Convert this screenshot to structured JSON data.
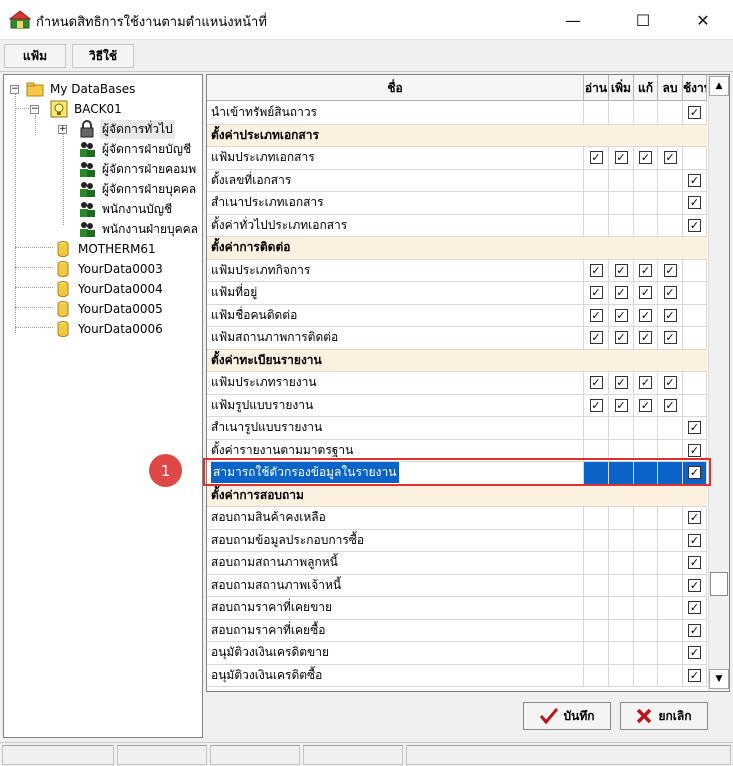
{
  "window": {
    "title": "กำหนดสิทธิการใช้งานตามตำแหน่งหน้าที่",
    "minimize_glyph": "—",
    "maximize_glyph": "☐",
    "close_glyph": "✕"
  },
  "menu": {
    "items": [
      "แฟ้ม",
      "วิธีใช้"
    ]
  },
  "tree": {
    "root": "My DataBases",
    "database": "BACK01",
    "roles": [
      "ผู้จัดการทั่วไป",
      "ผู้จัดการฝ่ายบัญชี",
      "ผู้จัดการฝ่ายคอมพ",
      "ผู้จัดการฝ่ายบุคคล",
      "พนักงานบัญชี",
      "พนักงานฝ่ายบุคคล"
    ],
    "other_databases": [
      "MOTHERM61",
      "YourData0003",
      "YourData0004",
      "YourData0005",
      "YourData0006"
    ]
  },
  "grid": {
    "columns": {
      "name": "ชื่อ",
      "read": "อ่าน",
      "add": "เพิ่ม",
      "edit": "แก้",
      "delete": "ลบ",
      "use": "ใช้งาน"
    },
    "rows": [
      {
        "type": "item",
        "name": "นำเข้าทรัพย์สินถาวร",
        "read": false,
        "add": false,
        "edit": false,
        "delete": false,
        "use": true
      },
      {
        "type": "section",
        "name": "ตั้งค่าประเภทเอกสาร"
      },
      {
        "type": "item",
        "name": "แฟ้มประเภทเอกสาร",
        "read": true,
        "add": true,
        "edit": true,
        "delete": true,
        "use": false
      },
      {
        "type": "item",
        "name": "ตั้งเลขที่เอกสาร",
        "read": false,
        "add": false,
        "edit": false,
        "delete": false,
        "use": true
      },
      {
        "type": "item",
        "name": "สำเนาประเภทเอกสาร",
        "read": false,
        "add": false,
        "edit": false,
        "delete": false,
        "use": true
      },
      {
        "type": "item",
        "name": "ตั้งค่าทั่วไปประเภทเอกสาร",
        "read": false,
        "add": false,
        "edit": false,
        "delete": false,
        "use": true
      },
      {
        "type": "section",
        "name": "ตั้งค่าการติดต่อ"
      },
      {
        "type": "item",
        "name": "แฟ้มประเภทกิจการ",
        "read": true,
        "add": true,
        "edit": true,
        "delete": true,
        "use": false
      },
      {
        "type": "item",
        "name": "แฟ้มที่อยู่",
        "read": true,
        "add": true,
        "edit": true,
        "delete": true,
        "use": false
      },
      {
        "type": "item",
        "name": "แฟ้มชื่อคนติดต่อ",
        "read": true,
        "add": true,
        "edit": true,
        "delete": true,
        "use": false
      },
      {
        "type": "item",
        "name": "แฟ้มสถานภาพการติดต่อ",
        "read": true,
        "add": true,
        "edit": true,
        "delete": true,
        "use": false
      },
      {
        "type": "section",
        "name": "ตั้งค่าทะเบียนรายงาน"
      },
      {
        "type": "item",
        "name": "แฟ้มประเภทรายงาน",
        "read": true,
        "add": true,
        "edit": true,
        "delete": true,
        "use": false
      },
      {
        "type": "item",
        "name": "แฟ้มรูปแบบรายงาน",
        "read": true,
        "add": true,
        "edit": true,
        "delete": true,
        "use": false
      },
      {
        "type": "item",
        "name": "สำเนารูปแบบรายงาน",
        "read": false,
        "add": false,
        "edit": false,
        "delete": false,
        "use": true
      },
      {
        "type": "item",
        "name": "ตั้งค่ารายงานตามมาตรฐาน",
        "read": false,
        "add": false,
        "edit": false,
        "delete": false,
        "use": true
      },
      {
        "type": "item",
        "name": "สามารถใช้ตัวกรองข้อมูลในรายงาน",
        "read": false,
        "add": false,
        "edit": false,
        "delete": false,
        "use": true,
        "selected": true
      },
      {
        "type": "section",
        "name": "ตั้งค่าการสอบถาม"
      },
      {
        "type": "item",
        "name": "สอบถามสินค้าคงเหลือ",
        "read": false,
        "add": false,
        "edit": false,
        "delete": false,
        "use": true
      },
      {
        "type": "item",
        "name": "สอบถามข้อมูลประกอบการซื้อ",
        "read": false,
        "add": false,
        "edit": false,
        "delete": false,
        "use": true
      },
      {
        "type": "item",
        "name": "สอบถามสถานภาพลูกหนี้",
        "read": false,
        "add": false,
        "edit": false,
        "delete": false,
        "use": true
      },
      {
        "type": "item",
        "name": "สอบถามสถานภาพเจ้าหนี้",
        "read": false,
        "add": false,
        "edit": false,
        "delete": false,
        "use": true
      },
      {
        "type": "item",
        "name": "สอบถามราคาที่เคยขาย",
        "read": false,
        "add": false,
        "edit": false,
        "delete": false,
        "use": true
      },
      {
        "type": "item",
        "name": "สอบถามราคาที่เคยซื้อ",
        "read": false,
        "add": false,
        "edit": false,
        "delete": false,
        "use": true
      },
      {
        "type": "item",
        "name": "อนุมัติวงเงินเครดิตขาย",
        "read": false,
        "add": false,
        "edit": false,
        "delete": false,
        "use": true
      },
      {
        "type": "item",
        "name": "อนุมัติวงเงินเครดิตซื้อ",
        "read": false,
        "add": false,
        "edit": false,
        "delete": false,
        "use": true
      }
    ]
  },
  "annotation": {
    "badge_number": "1"
  },
  "buttons": {
    "save": "บันทึก",
    "cancel": "ยกเลิก"
  },
  "colors": {
    "selection": "#0a64c8",
    "section_bg": "#fcf0e0",
    "highlight": "#e03030",
    "badge": "#e04848"
  }
}
